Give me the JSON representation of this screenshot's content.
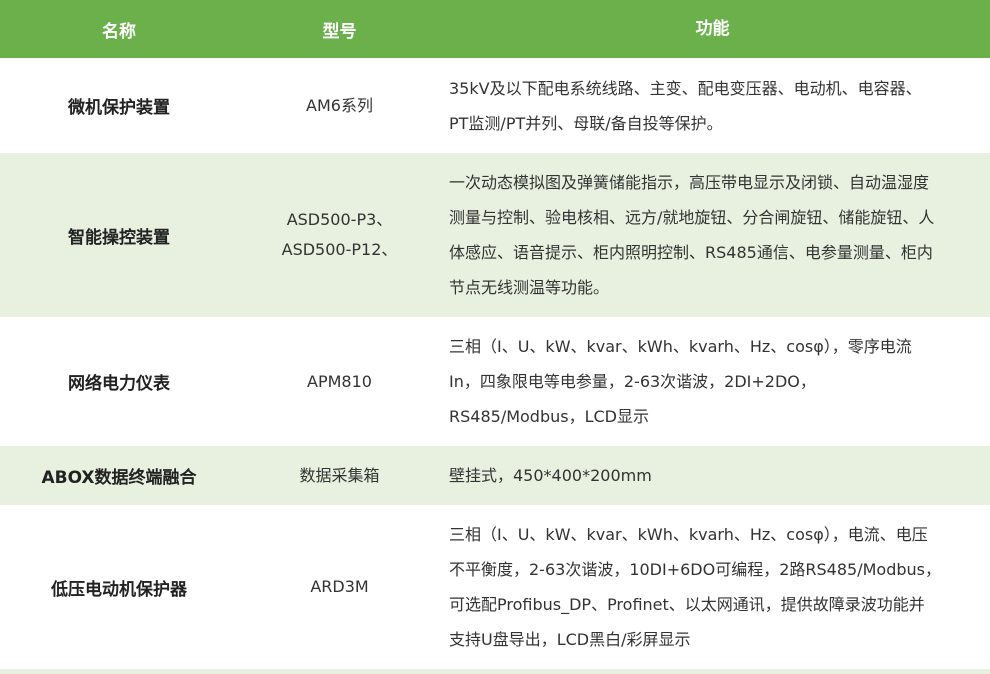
{
  "header": {
    "name": "名称",
    "model": "型号",
    "function": "功能"
  },
  "rows": [
    {
      "name": "微机保护装置",
      "model_lines": [
        "AM6系列"
      ],
      "function": "35kV及以下配电系统线路、主变、配电变压器、电动机、电容器、\nPT监测/PT并列、母联/备自投等保护。"
    },
    {
      "name": "智能操控装置",
      "model_lines": [
        "ASD500-P3、",
        "ASD500-P12、"
      ],
      "function": "一次动态模拟图及弹簧储能指示，高压带电显示及闭锁、自动温湿度\n测量与控制、验电核相、远方/就地旋钮、分合闸旋钮、储能旋钮、人\n体感应、语音提示、柜内照明控制、RS485通信、电参量测量、柜内\n节点无线测温等功能。"
    },
    {
      "name": "网络电力仪表",
      "model_lines": [
        "APM810"
      ],
      "function": "三相（I、U、kW、kvar、kWh、kvarh、Hz、cosφ），零序电流\nIn，四象限电等电参量，2-63次谐波，2DI+2DO，\nRS485/Modbus，LCD显示"
    },
    {
      "name": "ABOX数据终端融合",
      "model_lines": [
        "数据采集箱"
      ],
      "function": "壁挂式，450*400*200mm"
    },
    {
      "name": "低压电动机保护器",
      "model_lines": [
        "ARD3M"
      ],
      "function": "三相（I、U、kW、kvar、kWh、kvarh、Hz、cosφ），电流、电压\n不平衡度，2-63次谐波，10DI+6DO可编程，2路RS485/Modbus，\n可选配Profibus_DP、Profinet、以太网通讯，提供故障录波功能并\n支持U盘导出，LCD黑白/彩屏显示"
    }
  ],
  "colors": {
    "header_bg": "#6bb04a",
    "alt_row_bg": "#e8f1e0",
    "row_bg": "#ffffff"
  }
}
